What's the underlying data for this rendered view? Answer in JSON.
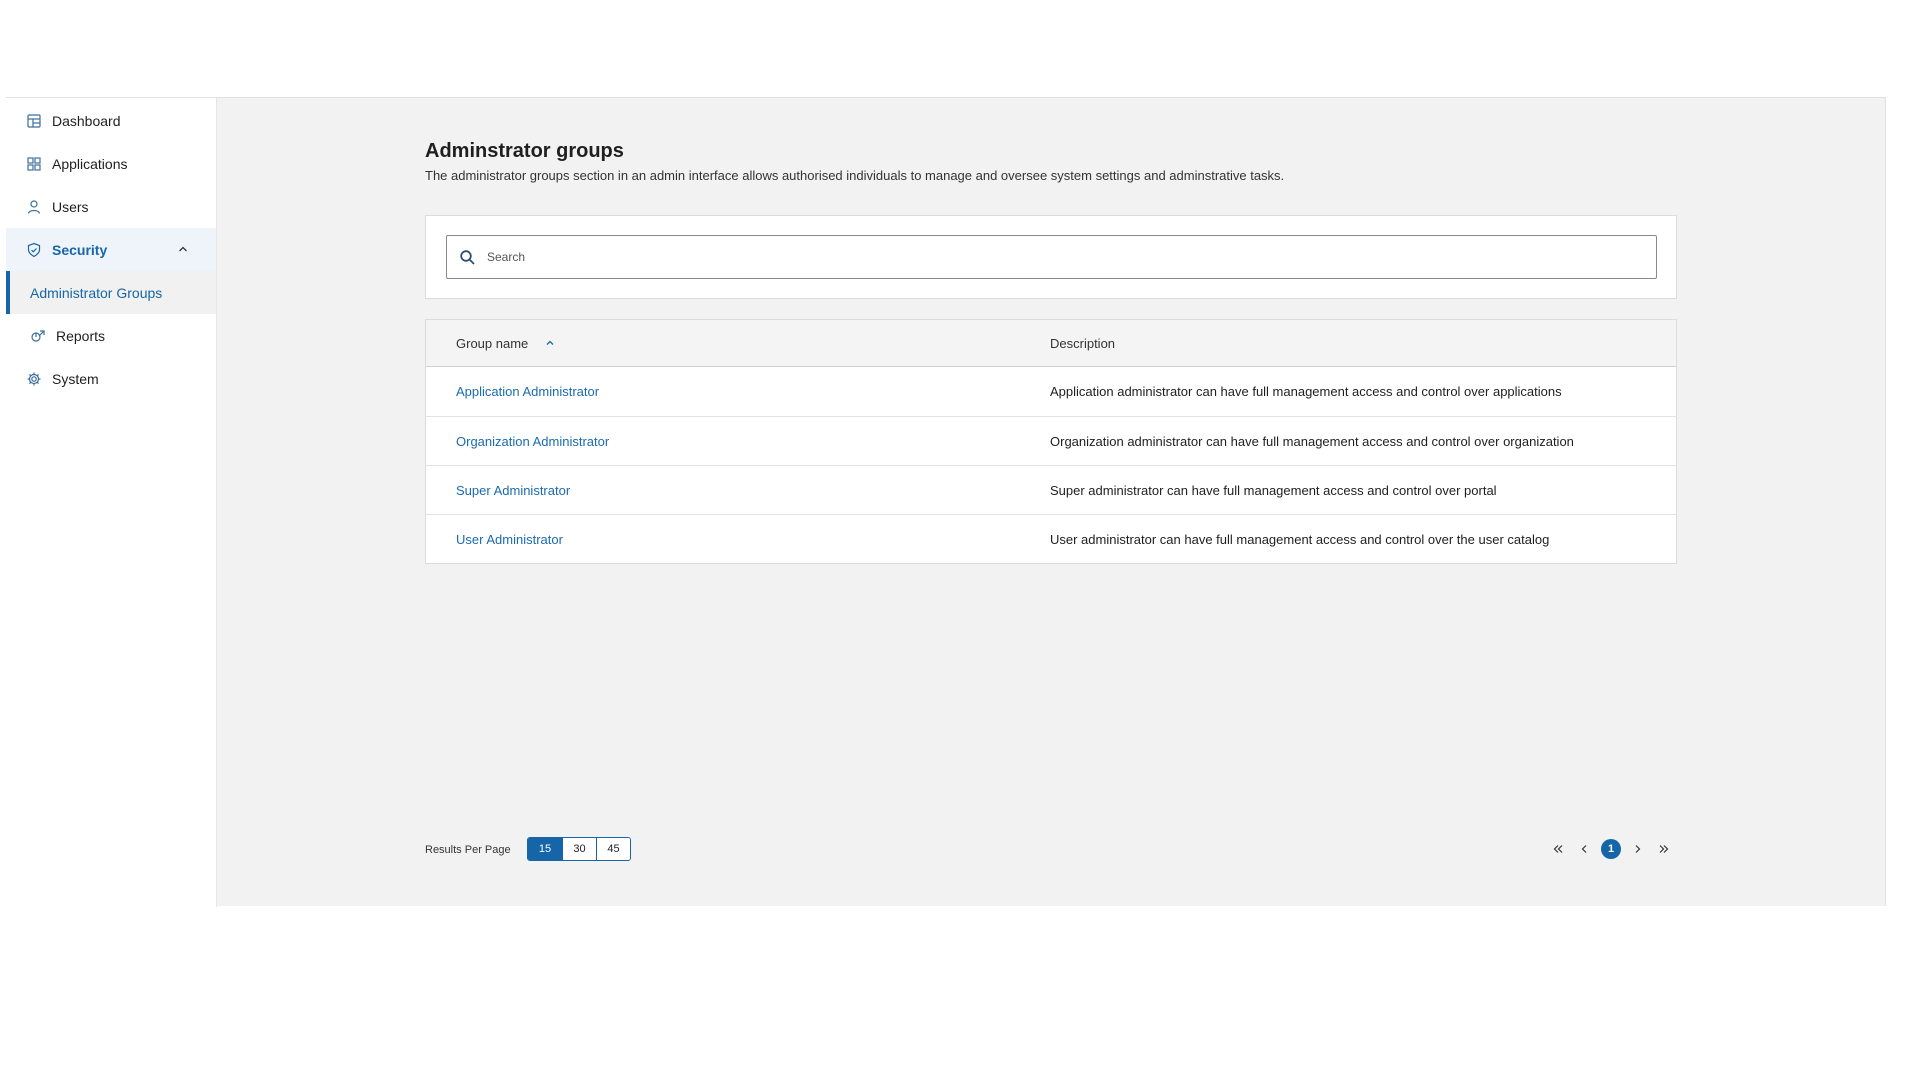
{
  "sidebar": {
    "items": [
      {
        "label": "Dashboard",
        "icon": "dashboard-icon"
      },
      {
        "label": "Applications",
        "icon": "applications-grid-icon"
      },
      {
        "label": "Users",
        "icon": "user-icon"
      },
      {
        "label": "Security",
        "icon": "shield-icon",
        "expanded": true
      },
      {
        "label": "Reports",
        "icon": "reports-icon"
      },
      {
        "label": "System",
        "icon": "gear-icon"
      }
    ],
    "security_sub": {
      "label": "Administrator Groups",
      "active": true
    }
  },
  "page": {
    "title": "Adminstrator groups",
    "description": "The administrator groups section in an admin interface allows authorised individuals to manage and oversee system settings and adminstrative tasks."
  },
  "search": {
    "placeholder": "Search",
    "value": ""
  },
  "table": {
    "columns": {
      "name": "Group name",
      "description": "Description",
      "sort": "ascending"
    },
    "rows": [
      {
        "name": "Application Administrator",
        "description": "Application administrator can have full management access and control over applications"
      },
      {
        "name": "Organization Administrator",
        "description": "Organization administrator can have full management access and control over organization"
      },
      {
        "name": "Super Administrator",
        "description": "Super administrator can have full management access and control over portal"
      },
      {
        "name": "User Administrator",
        "description": "User administrator can have full management access and control over the user catalog"
      }
    ]
  },
  "pagination": {
    "results_per_page_label": "Results Per Page",
    "options": [
      "15",
      "30",
      "45"
    ],
    "selected": "15",
    "current_page": "1"
  },
  "colors": {
    "accent": "#1565a8",
    "link": "#1a6bb0",
    "background": "#f2f2f2",
    "sidebar_active_bg": "#eef4fa"
  }
}
